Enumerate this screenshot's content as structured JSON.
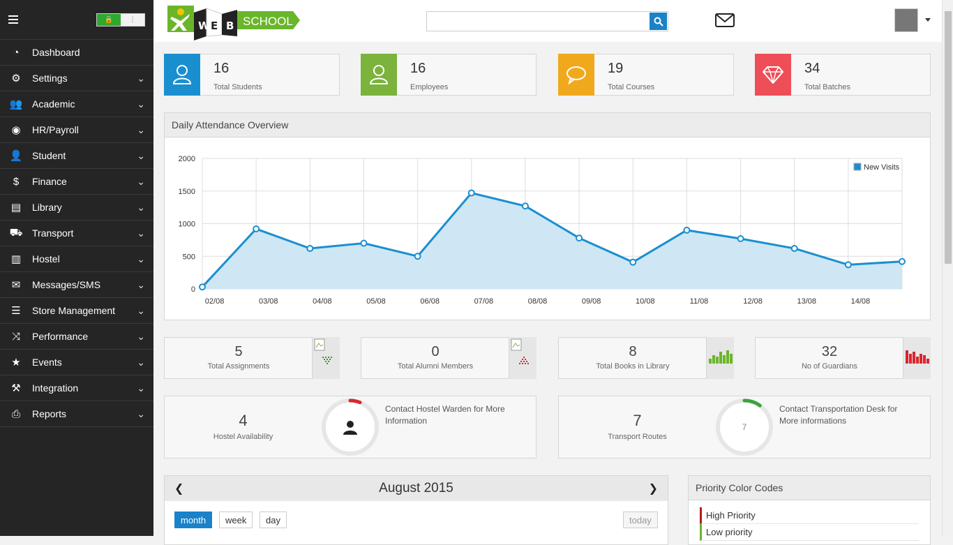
{
  "sidebar": {
    "items": [
      {
        "label": "Dashboard",
        "icon": "dashboard-icon",
        "glyph": "◔",
        "chevron": false
      },
      {
        "label": "Settings",
        "icon": "gears-icon",
        "glyph": "⚙",
        "chevron": true
      },
      {
        "label": "Academic",
        "icon": "group-icon",
        "glyph": "👥",
        "chevron": true
      },
      {
        "label": "HR/Payroll",
        "icon": "eye-icon",
        "glyph": "◉",
        "chevron": true
      },
      {
        "label": "Student",
        "icon": "user-icon",
        "glyph": "👤",
        "chevron": true
      },
      {
        "label": "Finance",
        "icon": "dollar-icon",
        "glyph": "$",
        "chevron": true
      },
      {
        "label": "Library",
        "icon": "book-icon",
        "glyph": "▤",
        "chevron": true
      },
      {
        "label": "Transport",
        "icon": "truck-icon",
        "glyph": "⛟",
        "chevron": true
      },
      {
        "label": "Hostel",
        "icon": "building-icon",
        "glyph": "▥",
        "chevron": true
      },
      {
        "label": "Messages/SMS",
        "icon": "envelope-icon",
        "glyph": "✉",
        "chevron": true
      },
      {
        "label": "Store Management",
        "icon": "server-icon",
        "glyph": "☰",
        "chevron": true
      },
      {
        "label": "Performance",
        "icon": "random-icon",
        "glyph": "⤨",
        "chevron": true
      },
      {
        "label": "Events",
        "icon": "star-icon",
        "glyph": "★",
        "chevron": true
      },
      {
        "label": "Integration",
        "icon": "gavel-icon",
        "glyph": "⚒",
        "chevron": true
      },
      {
        "label": "Reports",
        "icon": "print-icon",
        "glyph": "⎙",
        "chevron": true
      }
    ]
  },
  "header": {
    "logo_text_web": "WEB",
    "logo_text_school": "SCHOOL",
    "search_placeholder": ""
  },
  "stats": [
    {
      "value": "16",
      "label": "Total Students",
      "color": "#1a8fd0",
      "icon": "user-outline-icon"
    },
    {
      "value": "16",
      "label": "Employees",
      "color": "#7bb33d",
      "icon": "user-outline-icon"
    },
    {
      "value": "19",
      "label": "Total Courses",
      "color": "#f0a91d",
      "icon": "speech-bubble-icon"
    },
    {
      "value": "34",
      "label": "Total Batches",
      "color": "#ee4e58",
      "icon": "diamond-icon"
    }
  ],
  "attendance": {
    "title": "Daily Attendance Overview"
  },
  "chart_data": {
    "type": "area",
    "title": "",
    "categories": [
      "02/08",
      "03/08",
      "04/08",
      "05/08",
      "06/08",
      "07/08",
      "08/08",
      "09/08",
      "10/08",
      "11/08",
      "12/08",
      "13/08",
      "14/08"
    ],
    "series": [
      {
        "name": "New Visits",
        "x": [
          0,
          1,
          2,
          3,
          4,
          5,
          6,
          7,
          8,
          9,
          10,
          11,
          12,
          13
        ],
        "values": [
          30,
          920,
          620,
          700,
          500,
          1470,
          1270,
          780,
          410,
          900,
          770,
          620,
          370,
          420
        ]
      }
    ],
    "yticks": [
      0,
      500,
      1000,
      1500,
      2000
    ],
    "ylim": [
      0,
      2000
    ],
    "grid": true,
    "legend": "top-right",
    "color": "#1a8fd0",
    "fill": "#cfe6f4"
  },
  "mini_stats": [
    {
      "value": "5",
      "label": "Total Assignments",
      "graph": "broken-image-icon",
      "graph_color": "#2a9d2a"
    },
    {
      "value": "0",
      "label": "Total Alumni Members",
      "graph": "broken-image-icon",
      "graph_color": "#d9262e"
    },
    {
      "value": "8",
      "label": "Total Books in Library",
      "graph": "bar-sparkline",
      "graph_color": "#6ab52a",
      "bars": [
        0.3,
        0.5,
        0.4,
        0.7,
        0.5,
        0.8,
        0.6
      ]
    },
    {
      "value": "32",
      "label": "No of Guardians",
      "graph": "bar-sparkline",
      "graph_color": "#d9262e",
      "bars": [
        0.8,
        0.6,
        0.7,
        0.4,
        0.6,
        0.5,
        0.3
      ]
    }
  ],
  "hostel": {
    "value": "4",
    "label": "Hostel Availability",
    "message": "Contact Hostel Warden for More Information",
    "ring_color": "#d9262e",
    "ring_fraction": 0.06
  },
  "transport": {
    "value": "7",
    "label": "Transport Routes",
    "ring_value": "7",
    "message": "Contact Transportation Desk for More informations",
    "ring_color": "#3aa53a",
    "ring_fraction": 0.1
  },
  "calendar": {
    "title": "August 2015",
    "buttons": [
      "month",
      "week",
      "day"
    ],
    "today": "today",
    "active_color": "#1a82c8"
  },
  "priority": {
    "title": "Priority Color Codes",
    "items": [
      {
        "label": "High Priority",
        "color": "#b01e1e"
      },
      {
        "label": "Low priority",
        "color": "#6ab52a"
      }
    ]
  }
}
